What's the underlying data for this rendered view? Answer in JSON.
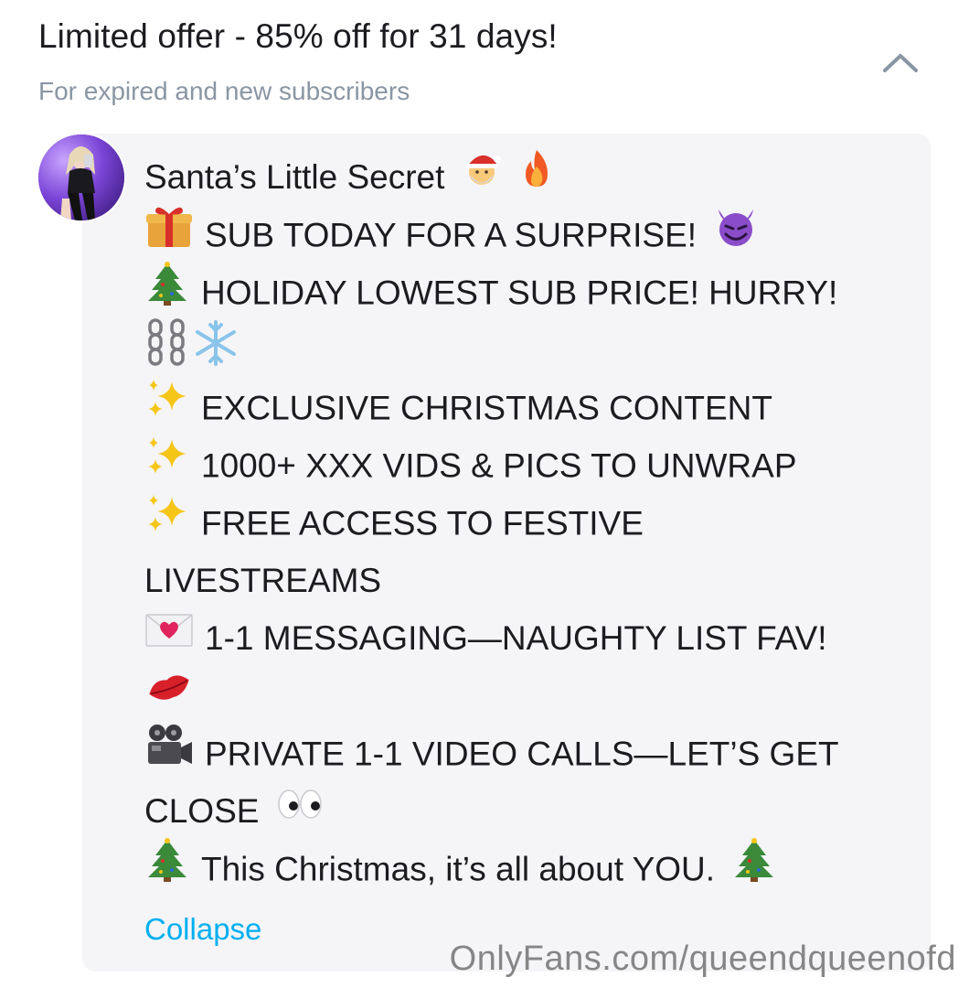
{
  "offer": {
    "title": "Limited offer - 85% off for 31 days!",
    "subtitle": "For expired and new subscribers"
  },
  "post": {
    "title": "Santa’s Little Secret",
    "lines": [
      "SUB TODAY FOR A SURPRISE!",
      "HOLIDAY LOWEST SUB PRICE! HURRY!",
      "",
      "EXCLUSIVE CHRISTMAS CONTENT",
      "1000+ XXX VIDS & PICS TO UNWRAP",
      "FREE ACCESS TO FESTIVE",
      "LIVESTREAMS",
      "1-1 MESSAGING—NAUGHTY LIST FAV!",
      "",
      "PRIVATE 1-1 VIDEO CALLS—LET’S GET",
      "CLOSE",
      "This Christmas, it’s all about YOU."
    ],
    "collapse_label": "Collapse"
  },
  "watermark": "OnlyFans.com/queendqueenofd",
  "icons": {
    "title": [
      "santa-face-icon",
      "fire-icon"
    ],
    "lines": [
      "gift-icon",
      "christmas-tree-icon",
      "chains-snowflake-icon",
      "sparkles-icon",
      "sparkles-icon",
      "sparkles-icon",
      "",
      "love-letter-icon",
      "lips-icon",
      "movie-camera-icon",
      "eyes-icon",
      "christmas-tree-icon"
    ],
    "collapse_toggle": "chevron-up-icon"
  },
  "colors": {
    "accent": "#00aff0",
    "subtitle": "#8a96a3",
    "text": "#1c1c20",
    "card_background": "#f5f5f8"
  }
}
